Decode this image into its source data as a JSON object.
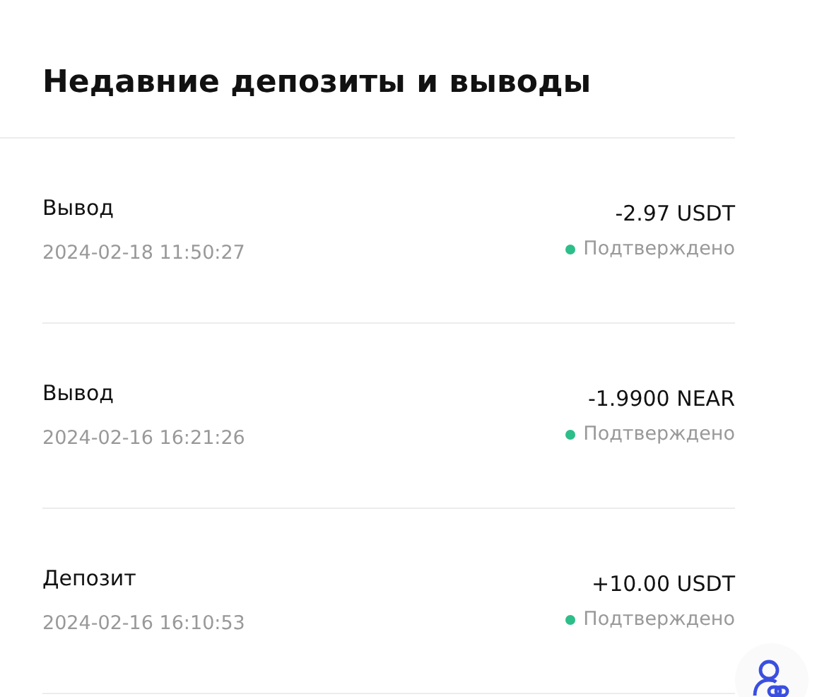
{
  "title": "Недавние депозиты и выводы",
  "transactions": [
    {
      "type": "Вывод",
      "date": "2024-02-18 11:50:27",
      "amount": "-2.97 USDT",
      "status": "Подтверждено",
      "color": "#2dbe8a"
    },
    {
      "type": "Вывод",
      "date": "2024-02-16 16:21:26",
      "amount": "-1.9900 NEAR",
      "status": "Подтверждено",
      "color": "#2dbe8a"
    },
    {
      "type": "Депозит",
      "date": "2024-02-16 16:10:53",
      "amount": "+10.00 USDT",
      "status": "Подтверждено",
      "color": "#2dbe8a"
    }
  ]
}
